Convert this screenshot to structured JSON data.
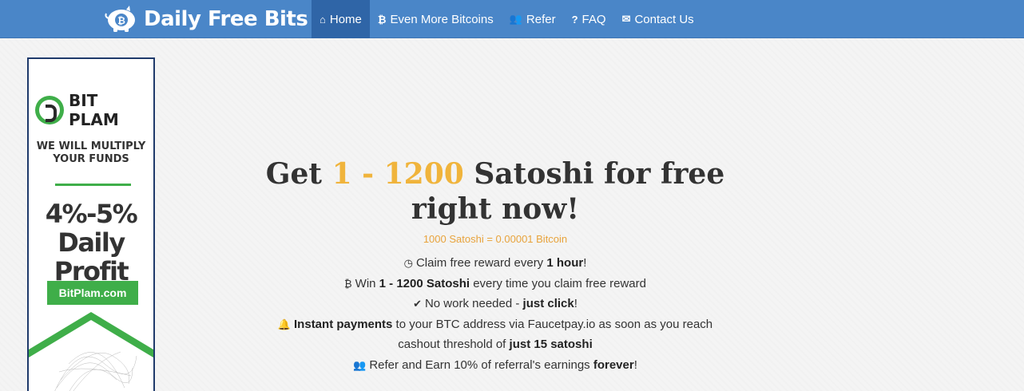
{
  "brand": {
    "name": "Daily Free Bits",
    "logo_icon": "piggy-bank-bitcoin-icon"
  },
  "nav": {
    "items": [
      {
        "icon": "home-icon",
        "glyph": "⌂",
        "label": "Home",
        "active": true
      },
      {
        "icon": "bitcoin-icon",
        "glyph": "₿",
        "label": "Even More Bitcoins"
      },
      {
        "icon": "users-icon",
        "glyph": "👥",
        "label": "Refer"
      },
      {
        "icon": "question-icon",
        "glyph": "?",
        "label": "FAQ"
      },
      {
        "icon": "envelope-icon",
        "glyph": "✉",
        "label": "Contact Us"
      }
    ]
  },
  "ad": {
    "logo_text": "BIT PLAM",
    "tagline": "WE WILL MULTIPLY YOUR FUNDS",
    "profit_line1": "4%-5%",
    "profit_line2": "Daily Profit",
    "button": "BitPlam.com"
  },
  "hero": {
    "title_pre": "Get ",
    "title_accent": "1 - 1200",
    "title_post": " Satoshi for free right now!",
    "conversion": "1000 Satoshi = 0.00001 Bitcoin"
  },
  "features": [
    {
      "icon": "clock-icon",
      "glyph": "◷",
      "parts": [
        [
          "Claim free reward every ",
          false
        ],
        [
          "1 hour",
          true
        ],
        [
          "!",
          false
        ]
      ]
    },
    {
      "icon": "bitcoin-icon",
      "glyph": "₿",
      "parts": [
        [
          "Win ",
          false
        ],
        [
          "1 - 1200 Satoshi",
          true
        ],
        [
          " every time you claim free reward",
          false
        ]
      ]
    },
    {
      "icon": "check-icon",
      "glyph": "✔",
      "parts": [
        [
          "No work needed - ",
          false
        ],
        [
          "just click",
          true
        ],
        [
          "!",
          false
        ]
      ]
    },
    {
      "icon": "bell-icon",
      "glyph": "🔔",
      "parts": [
        [
          "Instant payments",
          true
        ],
        [
          " to your BTC address via Faucetpay.io as soon as you reach cashout threshold of ",
          false
        ],
        [
          "just 15 satoshi",
          true
        ]
      ]
    },
    {
      "icon": "users-icon",
      "glyph": "👥",
      "parts": [
        [
          "Refer and Earn 10% of referral's earnings ",
          false
        ],
        [
          "forever",
          true
        ],
        [
          "!",
          false
        ]
      ]
    }
  ],
  "colors": {
    "navbar": "#4a86c8",
    "nav_active": "#2f65a7",
    "accent": "#f0b43c",
    "ad_green": "#3fae49"
  }
}
